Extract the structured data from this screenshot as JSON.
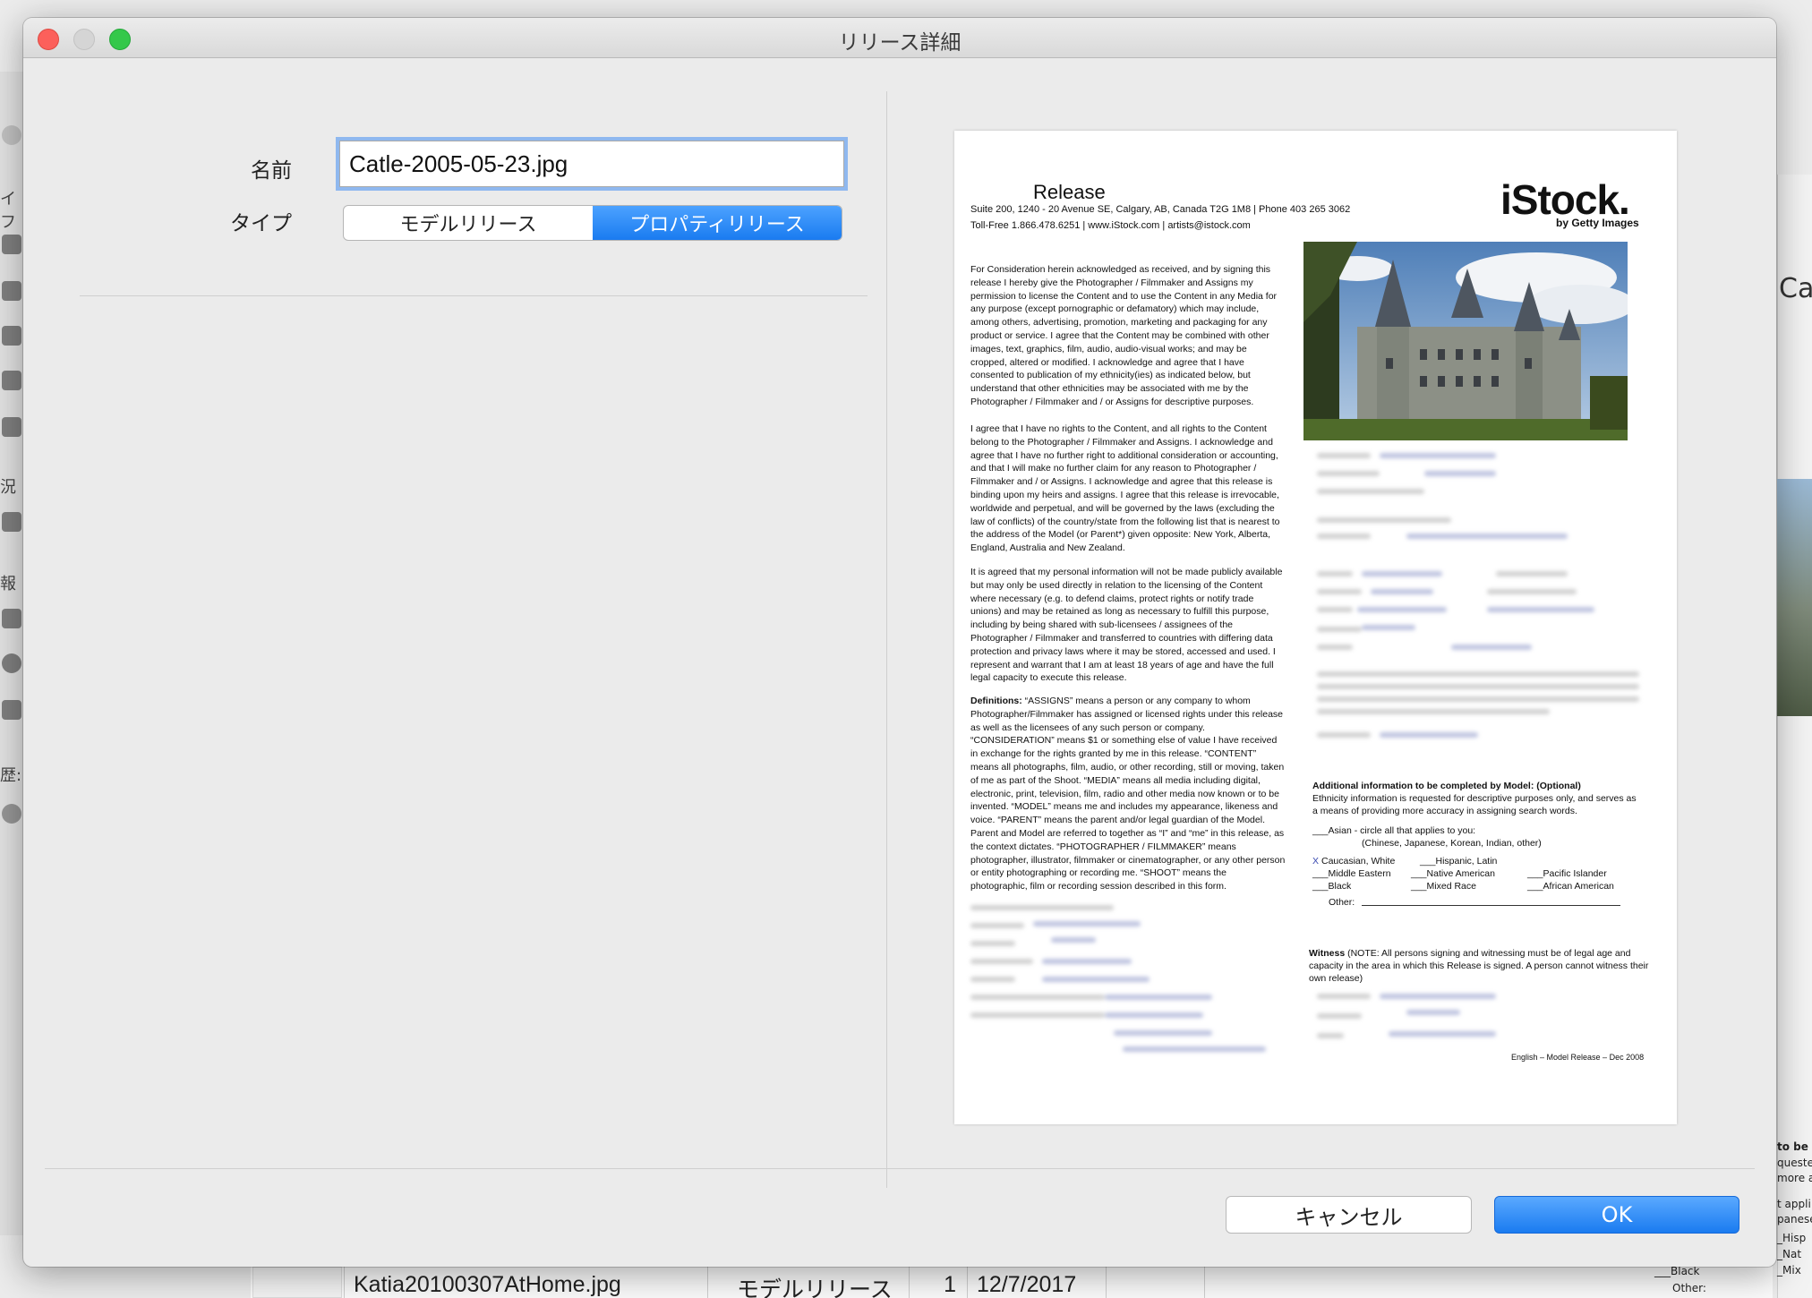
{
  "window": {
    "title": "リリース詳細"
  },
  "form": {
    "name_label": "名前",
    "name_value": "Catle-2005-05-23.jpg",
    "type_label": "タイプ",
    "type_options": [
      "モデルリリース",
      "プロパティリリース"
    ],
    "type_selected": "プロパティリリース"
  },
  "buttons": {
    "cancel": "キャンセル",
    "ok": "OK"
  },
  "document": {
    "title": "Release",
    "address_line": "Suite 200, 1240 - 20 Avenue SE, Calgary, AB, Canada  T2G 1M8 | Phone  403 265 3062",
    "contact_line": "Toll-Free  1.866.478.6251 | www.iStock.com  |  artists@istock.com",
    "logo": "iStock.",
    "logo_sub": "by Getty Images",
    "para1": "For Consideration herein acknowledged as received, and by signing this release I hereby give the Photographer / Filmmaker and Assigns my permission to license the Content and to use the Content in any Media for any purpose (except pornographic or defamatory) which may include, among others, advertising, promotion, marketing and packaging for any product or service. I agree that the Content may be combined with other images, text, graphics, film, audio, audio-visual works; and may be cropped, altered or modified. I acknowledge and agree that I have consented to publication of my ethnicity(ies) as indicated below, but understand that other ethnicities may be associated with me by the Photographer / Filmmaker and / or Assigns for descriptive purposes.",
    "para2": "I agree that I have no rights to the Content, and all rights to the Content belong to the Photographer / Filmmaker and Assigns. I acknowledge and agree that I have no further right to additional consideration or accounting, and that I will make no further claim for any reason to Photographer / Filmmaker and / or Assigns. I acknowledge and agree that this release is binding upon my heirs and assigns. I agree that this release is irrevocable, worldwide and perpetual, and will be governed by the laws (excluding the law of conflicts) of the country/state from the following list that is nearest to the address of the Model (or Parent*) given opposite: New York, Alberta, England, Australia and New Zealand.",
    "para3": "It is agreed that my personal information will not be made publicly available  but may only be used directly in relation to the licensing of the Content where necessary (e.g. to defend claims, protect rights or notify trade unions) and may be retained as long as necessary to fulfill this purpose, including by being shared with sub-licensees / assignees of the Photographer / Filmmaker and transferred to countries with differing data protection and privacy laws where it may be stored, accessed and used. I represent and warrant that I am at least 18 years of age and have the full legal capacity to execute this release.",
    "definitions_label": "Definitions:",
    "definitions": " “ASSIGNS” means a person or any company to whom Photographer/Filmmaker has assigned or licensed rights under this release as well as the licensees of any such person or company. “CONSIDERATION” means $1 or something else of value I have received in exchange for the rights granted by me in this release. “CONTENT” means all photographs, film, audio, or other recording, still or moving, taken of me as part of the Shoot. “MEDIA” means all media including digital, electronic, print, television, film, radio and other media now known or to be invented. “MODEL” means me and includes my appearance, likeness and voice. “PARENT” means the parent and/or legal guardian of the Model. Parent and Model are referred to together as “I” and “me” in this release, as the context dictates. “PHOTOGRAPHER / FILMMAKER” means photographer, illustrator, filmmaker or cinematographer, or any other person or entity photographing or recording me. “SHOOT” means the photographic, film or recording session described in this form.",
    "addl_title": "Additional information to be completed by Model: (Optional)",
    "addl_desc": "Ethnicity information is requested for descriptive purposes only, and serves as a means of providing more accuracy in assigning search words.",
    "asian": "___Asian  - circle all that applies to you:",
    "asian_sub": "(Chinese, Japanese, Korean, Indian, other)",
    "eth_row1": [
      "X",
      "Caucasian, White",
      "___Hispanic, Latin"
    ],
    "eth_row2": [
      "___Middle Eastern",
      "___Native American",
      "___Pacific Islander"
    ],
    "eth_row3": [
      "___Black",
      "___Mixed Race",
      "___African American"
    ],
    "other": "Other:",
    "witness_label": "Witness",
    "witness_note": " (NOTE: All persons signing and witnessing must be of legal age and capacity in the area in which this Release is signed. A person cannot witness their own release)",
    "footer": "English – Model Release – Dec 2008"
  },
  "background": {
    "table_row": {
      "filename": "Katia20100307AtHome.jpg",
      "type": "モデルリリース",
      "count": "1",
      "date": "12/7/2017"
    },
    "right_title": "Cat",
    "right_frags": [
      "to be c",
      "queste",
      "more a",
      "t appli",
      "panese",
      "_Hisp",
      "_Nat",
      "_Mix"
    ],
    "bottom_frags": [
      "___Black",
      "Other:"
    ],
    "sidebar_texts": [
      "イフ",
      "況",
      "報",
      "歴:"
    ]
  }
}
